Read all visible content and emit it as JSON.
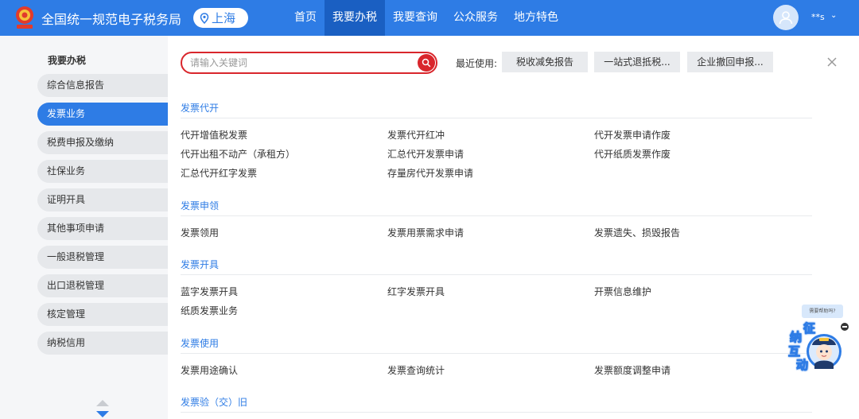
{
  "header": {
    "title": "全国统一规范电子税务局",
    "region": "上海",
    "nav": [
      "首页",
      "我要办税",
      "我要查询",
      "公众服务",
      "地方特色"
    ],
    "active_nav": 1,
    "username": "**s",
    "brand_color": "#2e7ce5"
  },
  "sidebar": {
    "title": "我要办税",
    "items": [
      "综合信息报告",
      "发票业务",
      "税费申报及缴纳",
      "社保业务",
      "证明开具",
      "其他事项申请",
      "一般退税管理",
      "出口退税管理",
      "核定管理",
      "纳税信用"
    ],
    "active_index": 1
  },
  "search": {
    "placeholder": "请输入关键词",
    "value": ""
  },
  "recent": {
    "label": "最近使用:",
    "items": [
      "税收减免报告",
      "一站式退抵税...",
      "企业撤回申报..."
    ]
  },
  "sections": [
    {
      "title": "发票代开",
      "links": [
        "代开增值税发票",
        "发票代开红冲",
        "代开发票申请作废",
        "代开出租不动产（承租方）",
        "汇总代开发票申请",
        "代开纸质发票作废",
        "汇总代开红字发票",
        "存量房代开发票申请"
      ]
    },
    {
      "title": "发票申领",
      "links": [
        "发票领用",
        "发票用票需求申请",
        "发票遗失、损毁报告"
      ]
    },
    {
      "title": "发票开具",
      "links": [
        "蓝字发票开具",
        "红字发票开具",
        "开票信息维护",
        "纸质发票业务"
      ]
    },
    {
      "title": "发票使用",
      "links": [
        "发票用途确认",
        "发票查询统计",
        "发票额度调整申请"
      ]
    },
    {
      "title": "发票验（交）旧",
      "links": []
    }
  ],
  "assistant": {
    "bubble": "需要帮助吗?",
    "chars": [
      "征",
      "纳",
      "互",
      "动"
    ]
  },
  "icons": {
    "logo": "tax-emblem-icon",
    "region": "location-pin-icon",
    "avatar": "user-avatar-icon",
    "search": "search-icon",
    "close": "close-icon"
  }
}
